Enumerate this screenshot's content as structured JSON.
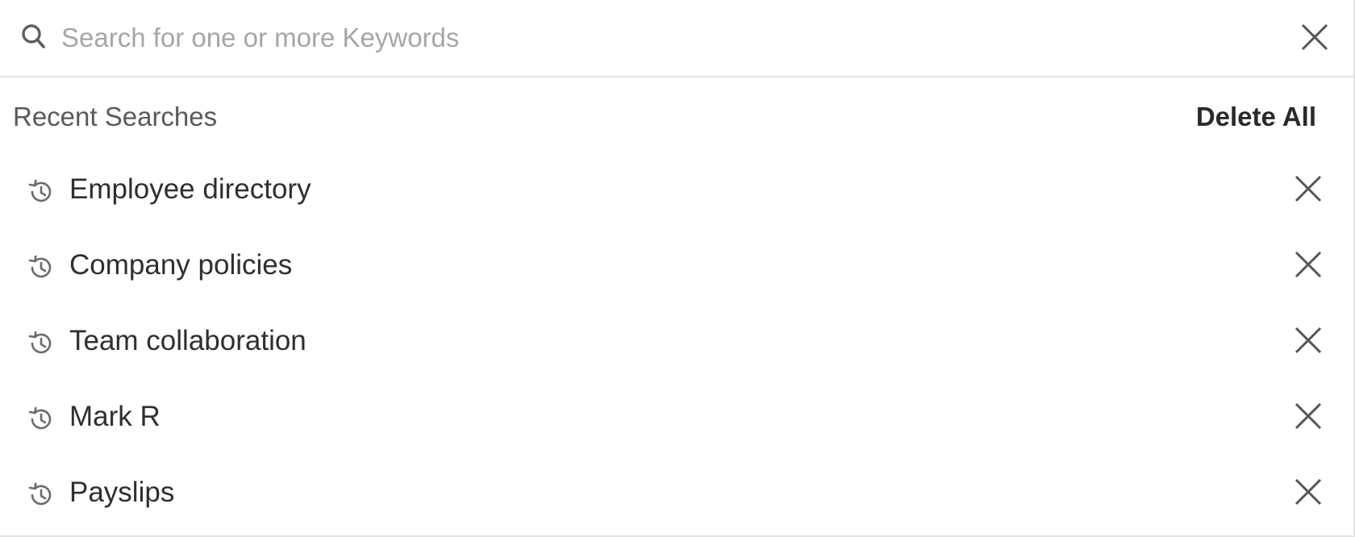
{
  "search": {
    "placeholder": "Search for one or more Keywords",
    "value": "",
    "icon": "search-icon",
    "clear_icon": "close-icon"
  },
  "recent": {
    "title": "Recent Searches",
    "delete_all_label": "Delete All",
    "item_icon": "history-icon",
    "remove_icon": "close-icon",
    "items": [
      {
        "label": "Employee directory"
      },
      {
        "label": "Company policies"
      },
      {
        "label": "Team collaboration"
      },
      {
        "label": "Mark R"
      },
      {
        "label": "Payslips"
      }
    ]
  },
  "colors": {
    "text": "#2f2f2f",
    "muted": "#5a5a5a",
    "placeholder": "#a6a6a6",
    "icon": "#6b6b6b",
    "divider": "#e2e2e2"
  }
}
